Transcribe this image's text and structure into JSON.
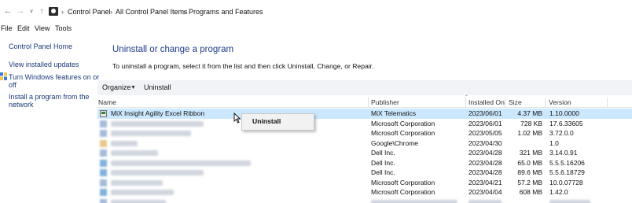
{
  "nav": {
    "back_icon": "arrow-left-icon",
    "forward_icon": "arrow-right-icon",
    "recent_icon": "chevron-down-icon",
    "up_icon": "arrow-up-icon",
    "location_icon": "control-panel-icon",
    "breadcrumbs": [
      "Control Panel",
      "All Control Panel Items",
      "Programs and Features"
    ]
  },
  "menubar": [
    "File",
    "Edit",
    "View",
    "Tools"
  ],
  "sidebar": {
    "home": "Control Panel Home",
    "updates": "View installed updates",
    "features_line1": "Turn Windows features on or",
    "features_line2": "off",
    "network_line1": "Install a program from the",
    "network_line2": "network"
  },
  "main": {
    "title": "Uninstall or change a program",
    "description": "To uninstall a program, select it from the list and then click Uninstall, Change, or Repair."
  },
  "toolbar": {
    "organize": "Organize",
    "uninstall": "Uninstall"
  },
  "table": {
    "columns": [
      "Name",
      "Publisher",
      "Installed On",
      "Size",
      "Version"
    ],
    "rows": [
      {
        "name": "MiX Insight Agility Excel Ribbon",
        "publisher": "MiX Telematics",
        "installed": "2023/06/01",
        "size": "4.37 MB",
        "version": "1.10.0000"
      },
      {
        "name": "",
        "publisher": "Microsoft Corporation",
        "installed": "2023/06/01",
        "size": "728 KB",
        "version": "17.6.33605"
      },
      {
        "name": "",
        "publisher": "Microsoft Corporation",
        "installed": "2023/05/05",
        "size": "1.02 MB",
        "version": "3.72.0.0"
      },
      {
        "name": "",
        "publisher": "Google\\Chrome",
        "installed": "2023/04/30",
        "size": "",
        "version": "1.0"
      },
      {
        "name": "",
        "publisher": "Dell Inc.",
        "installed": "2023/04/28",
        "size": "321 MB",
        "version": "3.14.0.91"
      },
      {
        "name": "",
        "publisher": "Dell Inc.",
        "installed": "2023/04/28",
        "size": "65.0 MB",
        "version": "5.5.5.16206"
      },
      {
        "name": "",
        "publisher": "Dell Inc.",
        "installed": "2023/04/28",
        "size": "89.6 MB",
        "version": "5.5.6.18729"
      },
      {
        "name": "",
        "publisher": "Microsoft Corporation",
        "installed": "2023/04/21",
        "size": "57.2 MB",
        "version": "10.0.07728"
      },
      {
        "name": "",
        "publisher": "Microsoft Corporation",
        "installed": "2023/04/04",
        "size": "608 MB",
        "version": "1.42.0"
      }
    ]
  },
  "context_menu": {
    "uninstall": "Uninstall"
  },
  "colors": {
    "selection": "#cce8ff",
    "title": "#1e3d8c",
    "link": "#1a3a7a",
    "toolbar_bg": "#f1f3f6"
  }
}
